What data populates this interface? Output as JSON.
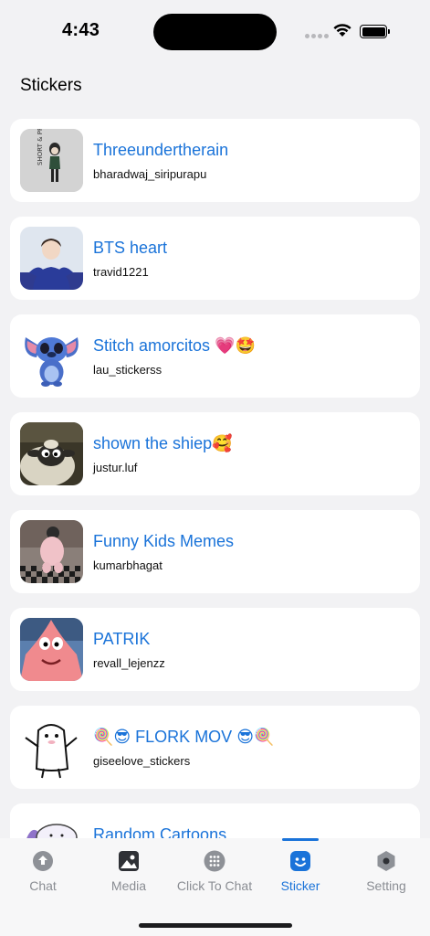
{
  "status": {
    "time": "4:43"
  },
  "page": {
    "title": "Stickers"
  },
  "packs": [
    {
      "title": "Threeundertherain",
      "author": "bharadwaj_siripurapu",
      "icon": "girl-sketch-thumbnail"
    },
    {
      "title": "BTS heart",
      "author": "travid1221",
      "icon": "person-photo-thumbnail"
    },
    {
      "title": "Stitch amorcitos 💗🤩",
      "author": "lau_stickerss",
      "icon": "stitch-thumbnail"
    },
    {
      "title": "shown the shiep🥰",
      "author": "justur.luf",
      "icon": "sheep-thumbnail"
    },
    {
      "title": "Funny Kids Memes",
      "author": "kumarbhagat",
      "icon": "kid-photo-thumbnail"
    },
    {
      "title": "PATRIK",
      "author": "revall_lejenzz",
      "icon": "patrick-thumbnail"
    },
    {
      "title": "🍭😎 FLORK MOV 😎🍭",
      "author": "giseelove_stickers",
      "icon": "flork-thumbnail"
    },
    {
      "title": "Random Cartoons",
      "author": "",
      "icon": "cartoon-thumbnail"
    }
  ],
  "tabs": [
    {
      "label": "Chat",
      "icon": "chat-icon",
      "active": false
    },
    {
      "label": "Media",
      "icon": "media-icon",
      "active": false
    },
    {
      "label": "Click To Chat",
      "icon": "dialpad-icon",
      "active": false
    },
    {
      "label": "Sticker",
      "icon": "sticker-icon",
      "active": true
    },
    {
      "label": "Setting",
      "icon": "settings-icon",
      "active": false
    }
  ],
  "colors": {
    "accent": "#1a73d9",
    "background": "#f2f2f4",
    "card": "#ffffff",
    "inactive": "#8a8d93"
  }
}
